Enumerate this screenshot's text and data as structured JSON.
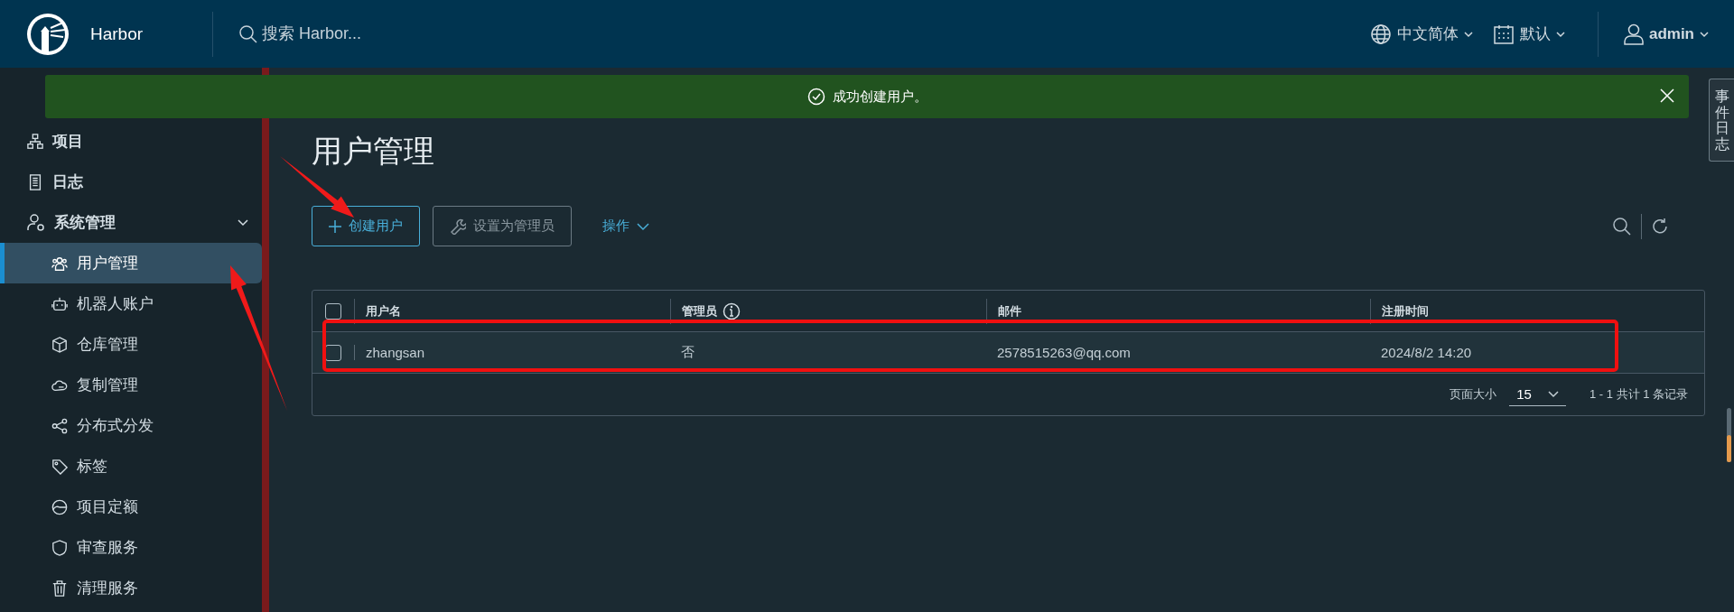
{
  "header": {
    "brand": "Harbor",
    "search": {
      "placeholder": "搜索 Harbor..."
    },
    "language": "中文简体",
    "date_format": "默认",
    "user": "admin"
  },
  "sidebar": {
    "items": [
      {
        "label": "项目",
        "selected": false
      },
      {
        "label": "日志",
        "selected": false
      },
      {
        "label": "系统管理",
        "selected": false,
        "expanded": true,
        "children": [
          {
            "label": "用户管理",
            "selected": true
          },
          {
            "label": "机器人账户",
            "selected": false
          },
          {
            "label": "仓库管理",
            "selected": false
          },
          {
            "label": "复制管理",
            "selected": false
          },
          {
            "label": "分布式分发",
            "selected": false
          },
          {
            "label": "标签",
            "selected": false
          },
          {
            "label": "项目定额",
            "selected": false
          },
          {
            "label": "审查服务",
            "selected": false
          },
          {
            "label": "清理服务",
            "selected": false
          }
        ]
      }
    ]
  },
  "notification": {
    "message": "成功创建用户。"
  },
  "event_tab": {
    "label": "事件日志"
  },
  "page": {
    "title": "用户管理",
    "toolbar": [
      {
        "kind": "primary",
        "label": "创建用户",
        "disabled": false
      },
      {
        "kind": "tool",
        "label": "设置为管理员",
        "disabled": true
      },
      {
        "kind": "dropdown",
        "label": "操作",
        "disabled": false
      }
    ],
    "table": {
      "select_all": {
        "checked": false
      },
      "columns": [
        {
          "label": "用户名",
          "info": false
        },
        {
          "label": "管理员",
          "info": true
        },
        {
          "label": "邮件",
          "info": false
        },
        {
          "label": "注册时间",
          "info": false
        }
      ],
      "rows": [
        {
          "checked": false,
          "cells": [
            "zhangsan",
            "否",
            "2578515263@qq.com",
            "2024/8/2 14:20"
          ]
        }
      ],
      "footer": {
        "page_size_label": "页面大小",
        "page_size": "15",
        "summary": "1 - 1 共计 1 条记录"
      }
    }
  },
  "annotations": [
    {
      "kind": "frame"
    },
    {
      "kind": "arrow"
    },
    {
      "kind": "arrow"
    }
  ]
}
